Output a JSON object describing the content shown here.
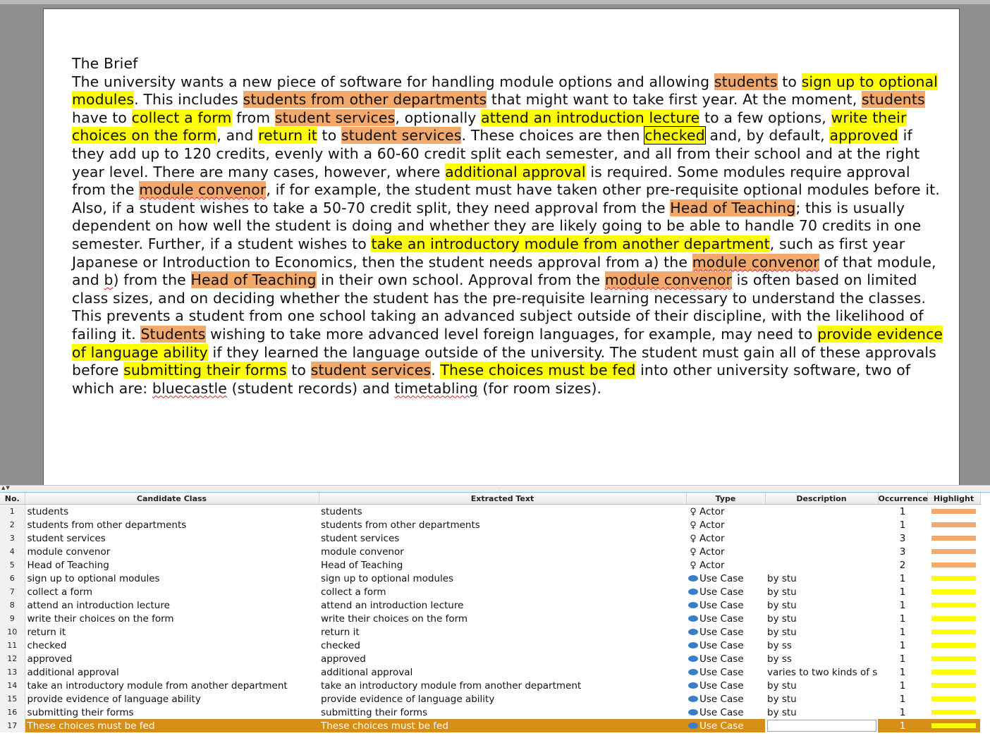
{
  "document": {
    "title": "The Brief",
    "segments": [
      {
        "t": "The university wants a new piece of software for handling module options and allowing "
      },
      {
        "t": "students",
        "hl": "actor"
      },
      {
        "t": " to "
      },
      {
        "t": "sign up to optional modules",
        "hl": "use"
      },
      {
        "t": ". This includes "
      },
      {
        "t": "students from other departments",
        "hl": "actor"
      },
      {
        "t": " that might want to take first year. At the moment, "
      },
      {
        "t": "students",
        "hl": "actor"
      },
      {
        "t": " have to "
      },
      {
        "t": "collect a form",
        "hl": "use"
      },
      {
        "t": " from "
      },
      {
        "t": "student services",
        "hl": "actor"
      },
      {
        "t": ", optionally "
      },
      {
        "t": "attend an introduction lecture",
        "hl": "use"
      },
      {
        "t": " to a few options, "
      },
      {
        "t": "write their choices on the form",
        "hl": "use"
      },
      {
        "t": ", and "
      },
      {
        "t": "return it",
        "hl": "use"
      },
      {
        "t": " to "
      },
      {
        "t": "student services",
        "hl": "actor"
      },
      {
        "t": ". These choices are then "
      },
      {
        "t": "checked",
        "hl": "boxed"
      },
      {
        "t": " and, by default, "
      },
      {
        "t": "approved",
        "hl": "use"
      },
      {
        "t": " if they add up to 120 credits, evenly with a 60-60 credit split each semester, and all from their school and at the right year level. There are many cases, however, where "
      },
      {
        "t": "additional approval",
        "hl": "use"
      },
      {
        "t": " is required. Some modules require approval from the "
      },
      {
        "t": "module convenor",
        "hl": "actor",
        "sq": true
      },
      {
        "t": ", if for example, the student must have taken other pre-requisite optional modules before it. Also, if a student wishes to take a 50-70 credit split, they need approval from the "
      },
      {
        "t": "Head of Teaching",
        "hl": "actor"
      },
      {
        "t": "; this is usually dependent on how well the student is doing and whether they are likely going to be able to handle 70 credits in one semester. Further, if a student wishes to "
      },
      {
        "t": "take an introductory module from another department",
        "hl": "use"
      },
      {
        "t": ", such as first year Japanese or Introduction to Economics, then the student needs approval from a) the "
      },
      {
        "t": "module convenor",
        "hl": "actor",
        "sq": true
      },
      {
        "t": " of that module, and "
      },
      {
        "t": "b",
        "sq": true
      },
      {
        "t": ") from the "
      },
      {
        "t": "Head of Teaching",
        "hl": "actor"
      },
      {
        "t": " in their own school. Approval from the "
      },
      {
        "t": "module convenor",
        "hl": "actor",
        "sq": true
      },
      {
        "t": " is often based on limited class sizes, and on deciding whether the student has the pre-requisite learning necessary to understand the classes. This prevents a student from one school taking an advanced subject outside of their discipline, with the likelihood of failing it. "
      },
      {
        "t": "Students",
        "hl": "actor"
      },
      {
        "t": " wishing to take more advanced level foreign languages, for example, may need to "
      },
      {
        "t": "provide evidence of language ability",
        "hl": "use"
      },
      {
        "t": " if they learned the language outside of the university. The student must gain all of these approvals before "
      },
      {
        "t": "submitting their forms",
        "hl": "use"
      },
      {
        "t": " to "
      },
      {
        "t": "student services",
        "hl": "actor"
      },
      {
        "t": ". "
      },
      {
        "t": "These choices must be fed",
        "hl": "use"
      },
      {
        "t": " into other university software, two of which are: "
      },
      {
        "t": "bluecastle",
        "sq": true
      },
      {
        "t": " (student records) and "
      },
      {
        "t": "timetabling",
        "sq": true
      },
      {
        "t": " (for room sizes)."
      }
    ]
  },
  "splitter": {
    "arrows": "▲▼",
    "grip": "◦"
  },
  "table": {
    "columns": [
      "No.",
      "Candidate Class",
      "Extracted Text",
      "Type",
      "Description",
      "Occurrence",
      "Highlight"
    ],
    "rows": [
      {
        "no": "1",
        "cls": "students",
        "text": "students",
        "type": "Actor",
        "icon": "actor-icon",
        "desc": "",
        "occ": "1",
        "color": "#f2a96b"
      },
      {
        "no": "2",
        "cls": "students from other departments",
        "text": "students from other departments",
        "type": "Actor",
        "icon": "actor-icon",
        "desc": "",
        "occ": "1",
        "color": "#f2a96b"
      },
      {
        "no": "3",
        "cls": "student services",
        "text": "student services",
        "type": "Actor",
        "icon": "actor-icon",
        "desc": "",
        "occ": "3",
        "color": "#f2a96b"
      },
      {
        "no": "4",
        "cls": "module convenor",
        "text": "module convenor",
        "type": "Actor",
        "icon": "actor-icon",
        "desc": "",
        "occ": "3",
        "color": "#f2a96b"
      },
      {
        "no": "5",
        "cls": "Head of Teaching",
        "text": "Head of Teaching",
        "type": "Actor",
        "icon": "actor-icon",
        "desc": "",
        "occ": "2",
        "color": "#f2a96b"
      },
      {
        "no": "6",
        "cls": "sign up to optional modules",
        "text": "sign up to optional modules",
        "type": "Use Case",
        "icon": "use-case-icon",
        "desc": "by stu",
        "occ": "1",
        "color": "#ffff00"
      },
      {
        "no": "7",
        "cls": "collect a form",
        "text": "collect a form",
        "type": "Use Case",
        "icon": "use-case-icon",
        "desc": "by stu",
        "occ": "1",
        "color": "#ffff00"
      },
      {
        "no": "8",
        "cls": "attend an introduction lecture",
        "text": "attend an introduction lecture",
        "type": "Use Case",
        "icon": "use-case-icon",
        "desc": "by stu",
        "occ": "1",
        "color": "#ffff00"
      },
      {
        "no": "9",
        "cls": "write their choices on the form",
        "text": "write their choices on the form",
        "type": "Use Case",
        "icon": "use-case-icon",
        "desc": "by stu",
        "occ": "1",
        "color": "#ffff00"
      },
      {
        "no": "10",
        "cls": "return it",
        "text": "return it",
        "type": "Use Case",
        "icon": "use-case-icon",
        "desc": "by stu",
        "occ": "1",
        "color": "#ffff00"
      },
      {
        "no": "11",
        "cls": "checked",
        "text": "checked",
        "type": "Use Case",
        "icon": "use-case-icon",
        "desc": "by ss",
        "occ": "1",
        "color": "#ffff00"
      },
      {
        "no": "12",
        "cls": "approved",
        "text": "approved",
        "type": "Use Case",
        "icon": "use-case-icon",
        "desc": "by ss",
        "occ": "1",
        "color": "#ffff00"
      },
      {
        "no": "13",
        "cls": "additional approval",
        "text": "additional approval",
        "type": "Use Case",
        "icon": "use-case-icon",
        "desc": "varies to two kinds of s",
        "occ": "1",
        "color": "#ffff00"
      },
      {
        "no": "14",
        "cls": "take an introductory module from another department",
        "text": "take an introductory module from another department",
        "type": "Use Case",
        "icon": "use-case-icon",
        "desc": "by stu",
        "occ": "1",
        "color": "#ffff00"
      },
      {
        "no": "15",
        "cls": "provide evidence of language ability",
        "text": "provide evidence of language ability",
        "type": "Use Case",
        "icon": "use-case-icon",
        "desc": "by stu",
        "occ": "1",
        "color": "#ffff00"
      },
      {
        "no": "16",
        "cls": "submitting their forms",
        "text": "submitting their forms",
        "type": "Use Case",
        "icon": "use-case-icon",
        "desc": "by stu",
        "occ": "1",
        "color": "#ffff00"
      },
      {
        "no": "17",
        "cls": "These choices must be fed",
        "text": "These choices must be fed",
        "type": "Use Case",
        "icon": "use-case-icon",
        "desc": "",
        "occ": "1",
        "color": "#ffff00",
        "selected": true
      }
    ]
  },
  "colors": {
    "actor": "#f2a96b",
    "use_case": "#ffff00",
    "selection": "#d58e17",
    "use_case_icon": "#3a7ec8"
  }
}
